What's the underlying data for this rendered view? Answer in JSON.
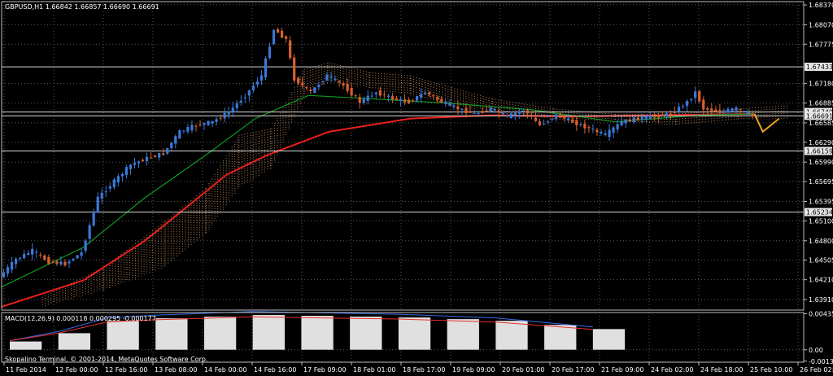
{
  "chart_data": {
    "type": "candlestick",
    "symbol_header": "GBPUSD,H1  1.66842 1.66857 1.66690 1.66691",
    "price_axis": {
      "ylim": [
        1.6375,
        1.6842
      ],
      "ticks": [
        "1.68370",
        "1.68070",
        "1.67775",
        "1.67180",
        "1.66885",
        "1.66585",
        "1.66290",
        "1.65990",
        "1.65695",
        "1.65395",
        "1.65100",
        "1.64800",
        "1.64505",
        "1.64210",
        "1.63910"
      ]
    },
    "horizontal_levels": [
      {
        "value": 1.67433,
        "label": "1.67433"
      },
      {
        "value": 1.66749,
        "label": "1.66749"
      },
      {
        "value": 1.66691,
        "label": "1.66691"
      },
      {
        "value": 1.66159,
        "label": "1.66159"
      },
      {
        "value": 1.65234,
        "label": "1.65234"
      }
    ],
    "time_axis": [
      "11 Feb 2014",
      "12 Feb 00:00",
      "12 Feb 16:00",
      "13 Feb 08:00",
      "14 Feb 00:00",
      "14 Feb 16:00",
      "17 Feb 09:00",
      "18 Feb 01:00",
      "18 Feb 17:00",
      "19 Feb 09:00",
      "20 Feb 01:00",
      "20 Feb 17:00",
      "21 Feb 09:00",
      "24 Feb 02:00",
      "24 Feb 18:00",
      "25 Feb 10:00",
      "26 Feb 02:00"
    ],
    "price_path": [
      [
        0,
        1.6425
      ],
      [
        4,
        1.6452
      ],
      [
        8,
        1.6465
      ],
      [
        12,
        1.6448
      ],
      [
        16,
        1.6445
      ],
      [
        20,
        1.6462
      ],
      [
        24,
        1.6545
      ],
      [
        28,
        1.657
      ],
      [
        32,
        1.6595
      ],
      [
        36,
        1.6605
      ],
      [
        40,
        1.6612
      ],
      [
        44,
        1.6645
      ],
      [
        48,
        1.6655
      ],
      [
        52,
        1.666
      ],
      [
        56,
        1.6675
      ],
      [
        60,
        1.67
      ],
      [
        64,
        1.673
      ],
      [
        67,
        1.68
      ],
      [
        70,
        1.6785
      ],
      [
        72,
        1.6725
      ],
      [
        76,
        1.6705
      ],
      [
        80,
        1.673
      ],
      [
        84,
        1.6715
      ],
      [
        88,
        1.669
      ],
      [
        92,
        1.6705
      ],
      [
        96,
        1.6695
      ],
      [
        100,
        1.669
      ],
      [
        104,
        1.6705
      ],
      [
        108,
        1.669
      ],
      [
        112,
        1.668
      ],
      [
        116,
        1.6672
      ],
      [
        120,
        1.668
      ],
      [
        124,
        1.6668
      ],
      [
        128,
        1.6678
      ],
      [
        132,
        1.6655
      ],
      [
        136,
        1.667
      ],
      [
        140,
        1.666
      ],
      [
        144,
        1.665
      ],
      [
        148,
        1.664
      ],
      [
        152,
        1.666
      ],
      [
        156,
        1.6665
      ],
      [
        160,
        1.6668
      ],
      [
        164,
        1.6672
      ],
      [
        168,
        1.669
      ],
      [
        170,
        1.6705
      ],
      [
        172,
        1.668
      ],
      [
        176,
        1.6675
      ],
      [
        180,
        1.668
      ],
      [
        184,
        1.6669
      ]
    ],
    "forecast_path": [
      [
        184,
        1.6672
      ],
      [
        186,
        1.6645
      ],
      [
        190,
        1.6665
      ]
    ],
    "overlays": [
      {
        "name": "ma_red",
        "color": "#e8201c",
        "points": [
          [
            0,
            1.638
          ],
          [
            20,
            1.642
          ],
          [
            35,
            1.648
          ],
          [
            45,
            1.653
          ],
          [
            55,
            1.658
          ],
          [
            65,
            1.661
          ],
          [
            80,
            1.6645
          ],
          [
            100,
            1.6665
          ],
          [
            120,
            1.667
          ],
          [
            140,
            1.6668
          ],
          [
            160,
            1.667
          ],
          [
            184,
            1.6672
          ]
        ]
      },
      {
        "name": "ma_green",
        "color": "#0e9a20",
        "points": [
          [
            0,
            1.641
          ],
          [
            20,
            1.647
          ],
          [
            35,
            1.6545
          ],
          [
            50,
            1.661
          ],
          [
            62,
            1.6665
          ],
          [
            75,
            1.67
          ],
          [
            90,
            1.6695
          ],
          [
            110,
            1.6688
          ],
          [
            130,
            1.6678
          ],
          [
            150,
            1.666
          ],
          [
            170,
            1.667
          ],
          [
            184,
            1.6672
          ]
        ]
      }
    ],
    "cloud": [
      [
        10,
        1.638,
        1.6395
      ],
      [
        25,
        1.6405,
        1.644
      ],
      [
        40,
        1.644,
        1.651
      ],
      [
        50,
        1.649,
        1.656
      ],
      [
        58,
        1.656,
        1.664
      ],
      [
        66,
        1.659,
        1.665
      ],
      [
        74,
        1.67,
        1.674
      ],
      [
        80,
        1.672,
        1.675
      ],
      [
        90,
        1.671,
        1.6735
      ],
      [
        100,
        1.67,
        1.673
      ],
      [
        110,
        1.6685,
        1.6712
      ],
      [
        120,
        1.6675,
        1.6695
      ],
      [
        135,
        1.6662,
        1.668
      ],
      [
        150,
        1.666,
        1.6672
      ],
      [
        165,
        1.6655,
        1.6672
      ],
      [
        180,
        1.6662,
        1.668
      ],
      [
        192,
        1.6665,
        1.6685
      ]
    ],
    "macd": {
      "label": "MACD(12,26,9) 0.000118 0.000295 -0.000177",
      "ylim": [
        -0.0015,
        0.0045
      ],
      "ticks": [
        "0.004351",
        "0.00",
        "-0.001381"
      ],
      "histogram": [
        0.001,
        0.002,
        0.0035,
        0.0038,
        0.004,
        0.0042,
        0.0041,
        0.004,
        0.0039,
        0.0037,
        0.0035,
        0.003,
        0.0025,
        0.0018,
        0.001,
        0.0005,
        0.0002,
        -0.0003,
        -0.0007,
        -0.0008,
        -0.0006,
        -0.0003,
        0.0001,
        0.0002,
        0.0003,
        -0.0001,
        -0.0002,
        0.0001,
        0.0003,
        0.0002,
        0,
        -0.0002,
        -0.0003,
        -0.0002,
        0.0001,
        0.0003,
        0.0004,
        0.0002,
        0,
        -0.0002,
        -0.0004,
        -0.0003,
        -0.0001,
        0.0002,
        0.0004,
        0.0005,
        0.0003,
        0.0001,
        -0.0001,
        -0.0002
      ]
    },
    "footer": "Skopalino Terminal, © 2001-2014, MetaQuotes Software Corp."
  },
  "colors": {
    "background": "#000000",
    "grid": "#5a5a5a",
    "bull": "#3a78d8",
    "bear": "#d8602c",
    "cloud": "#d89a6a",
    "levels": "#d8d8d8",
    "forecast": "#f0a020"
  }
}
